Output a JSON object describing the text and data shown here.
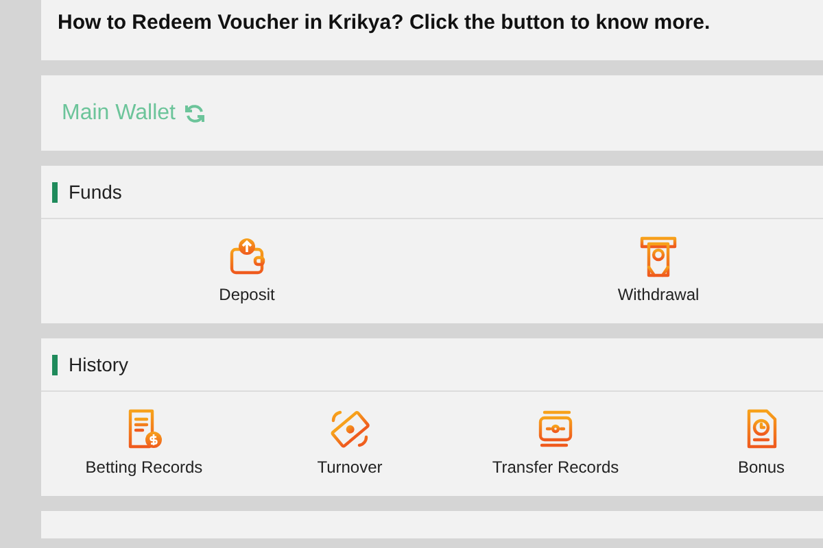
{
  "notice": "How to Redeem Voucher in Krikya? Click the button to know more.",
  "wallet": {
    "label": "Main Wallet"
  },
  "sections": [
    {
      "title": "Funds",
      "items": [
        {
          "label": "Deposit",
          "kind": "wallet"
        },
        {
          "label": "Withdrawal",
          "kind": "atm"
        }
      ]
    },
    {
      "title": "History",
      "items": [
        {
          "label": "Betting Records",
          "kind": "receipt"
        },
        {
          "label": "Turnover",
          "kind": "cash"
        },
        {
          "label": "Transfer Records",
          "kind": "transfer"
        },
        {
          "label": "Bonus",
          "kind": "clock"
        }
      ]
    }
  ]
}
